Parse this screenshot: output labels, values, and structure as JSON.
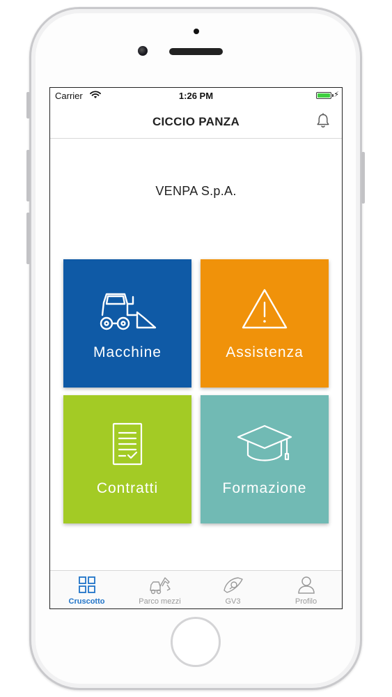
{
  "status_bar": {
    "carrier": "Carrier",
    "time": "1:26 PM"
  },
  "nav": {
    "title": "CICCIO PANZA",
    "icon": "bell-icon"
  },
  "company": "VENPA S.p.A.",
  "tiles": [
    {
      "label": "Macchine",
      "icon": "tractor-icon",
      "color": "#0f5aa6"
    },
    {
      "label": "Assistenza",
      "icon": "warning-icon",
      "color": "#f0920a"
    },
    {
      "label": "Contratti",
      "icon": "contract-icon",
      "color": "#a3cb25"
    },
    {
      "label": "Formazione",
      "icon": "graduation-cap-icon",
      "color": "#71bab4"
    }
  ],
  "tabs": [
    {
      "label": "Cruscotto",
      "icon": "dashboard-grid-icon",
      "active": true
    },
    {
      "label": "Parco mezzi",
      "icon": "fleet-icon",
      "active": false
    },
    {
      "label": "GV3",
      "icon": "gv3-icon",
      "active": false
    },
    {
      "label": "Profilo",
      "icon": "profile-icon",
      "active": false
    }
  ],
  "colors": {
    "accent": "#1f73c8",
    "inactive": "#9a9a9a",
    "battery": "#3fcf40"
  }
}
